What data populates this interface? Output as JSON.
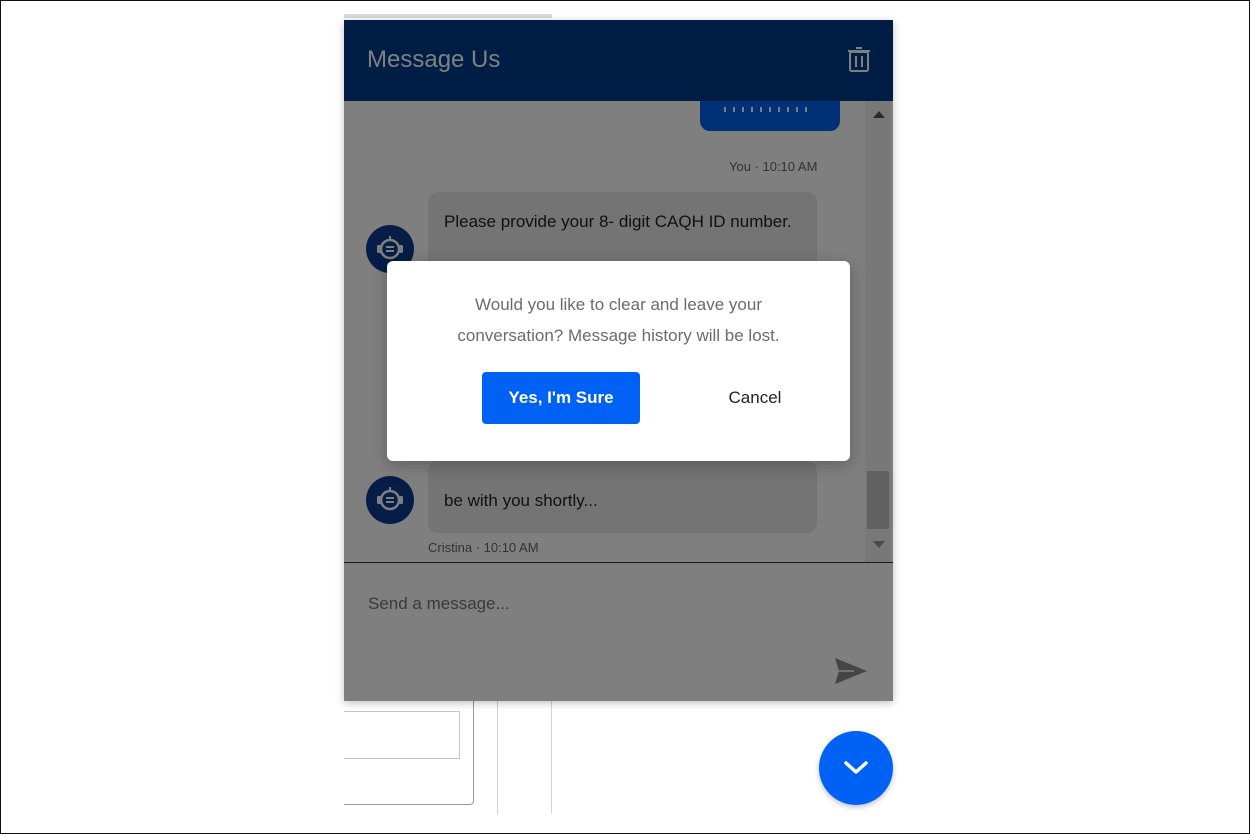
{
  "chat": {
    "title": "Message Us",
    "header_color": "#003a8c",
    "messages": [
      {
        "sender": "You",
        "time_label": "You · 10:10 AM",
        "text": ""
      },
      {
        "sender": "bot",
        "text": "Please provide your 8- digit CAQH ID number."
      },
      {
        "sender": "bot",
        "text": "be with you shortly...",
        "time_label": "Cristina · 10:10 AM"
      }
    ],
    "composer": {
      "placeholder": "Send a message..."
    }
  },
  "dialog": {
    "message": "Would you like to clear and leave your conversation? Message history will be lost.",
    "confirm_label": "Yes, I'm Sure",
    "cancel_label": "Cancel"
  },
  "icons": {
    "trash": "trash-icon",
    "bot_avatar": "bot-icon",
    "send": "send-icon",
    "fab": "chevron-down-icon"
  },
  "colors": {
    "primary": "#0062f5",
    "header": "#003a8c",
    "avatar": "#0a3b8f"
  }
}
